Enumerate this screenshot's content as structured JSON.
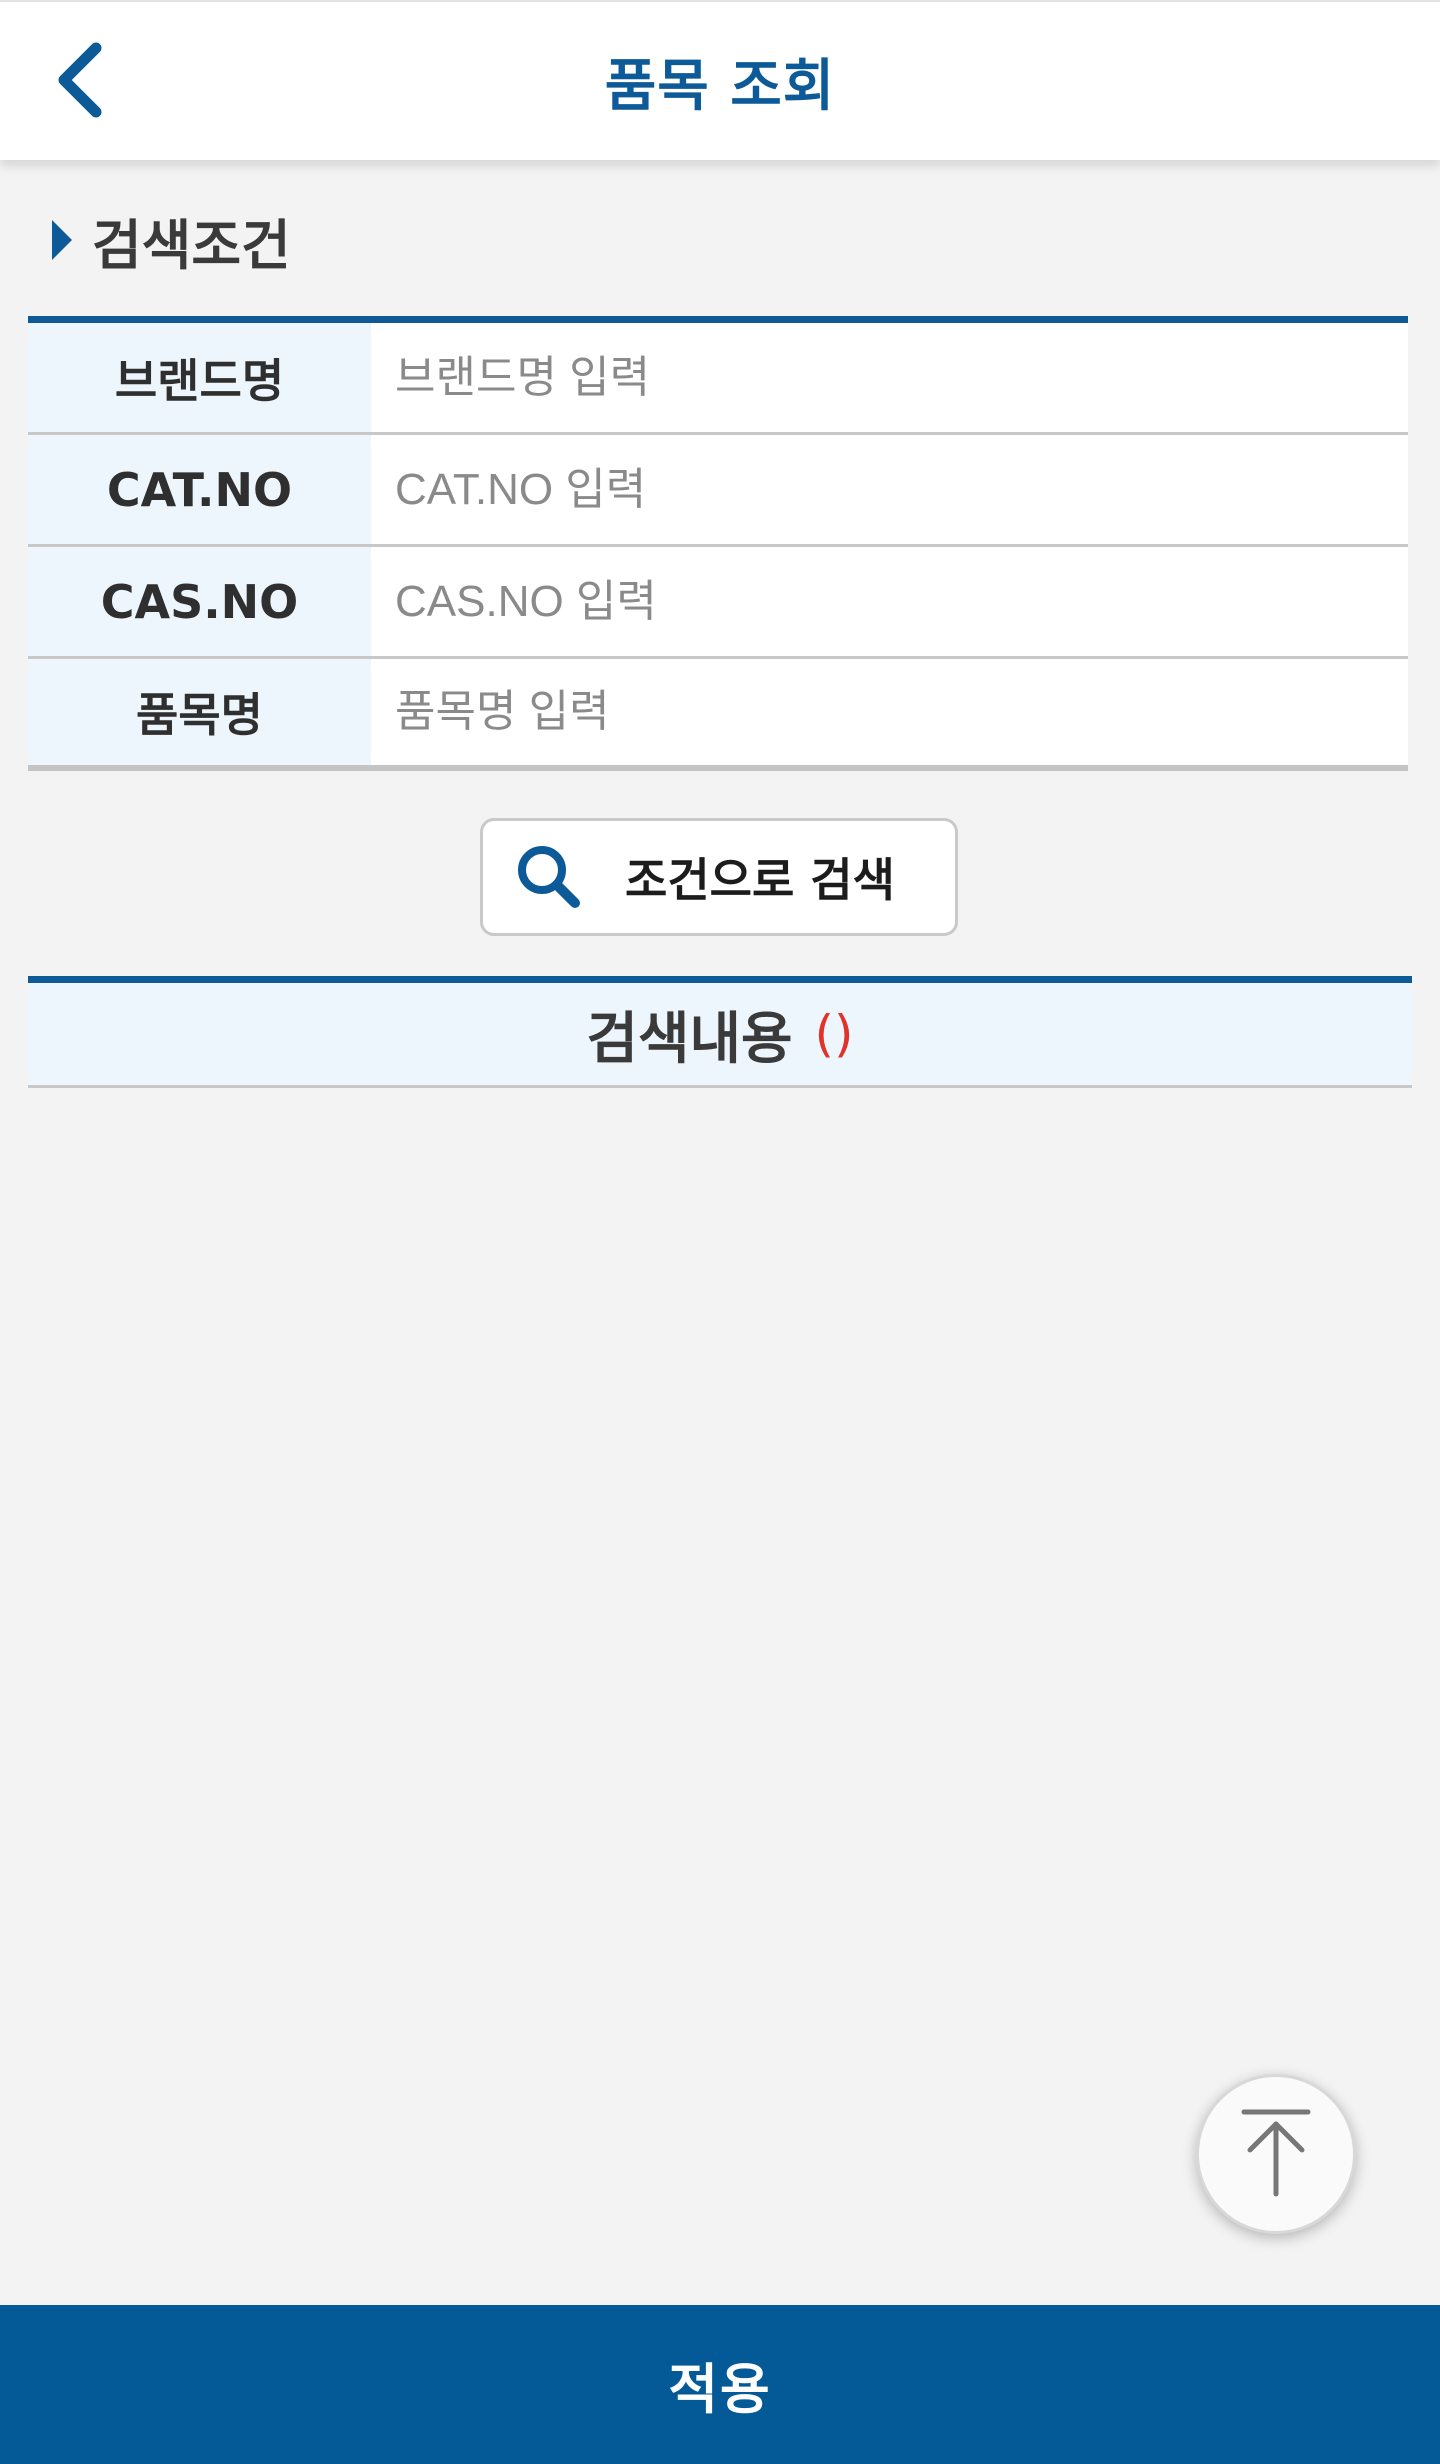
{
  "header": {
    "title": "품목 조회",
    "back_icon": "chevron-left-icon",
    "accent_color": "#0c5a97"
  },
  "search": {
    "section_title": "검색조건",
    "fields": [
      {
        "label": "브랜드명",
        "placeholder": "브랜드명 입력",
        "value": ""
      },
      {
        "label": "CAT.NO",
        "placeholder": "CAT.NO 입력",
        "value": ""
      },
      {
        "label": "CAS.NO",
        "placeholder": "CAS.NO 입력",
        "value": ""
      },
      {
        "label": "품목명",
        "placeholder": "품목명 입력",
        "value": ""
      }
    ],
    "button_label": "조건으로 검색",
    "button_icon": "search-icon"
  },
  "results": {
    "title": "검색내용",
    "count": "()",
    "count_color": "#e0342b"
  },
  "scroll_top": {
    "icon": "arrow-up-to-top-icon"
  },
  "footer": {
    "apply_label": "적용",
    "background": "#045a96"
  }
}
